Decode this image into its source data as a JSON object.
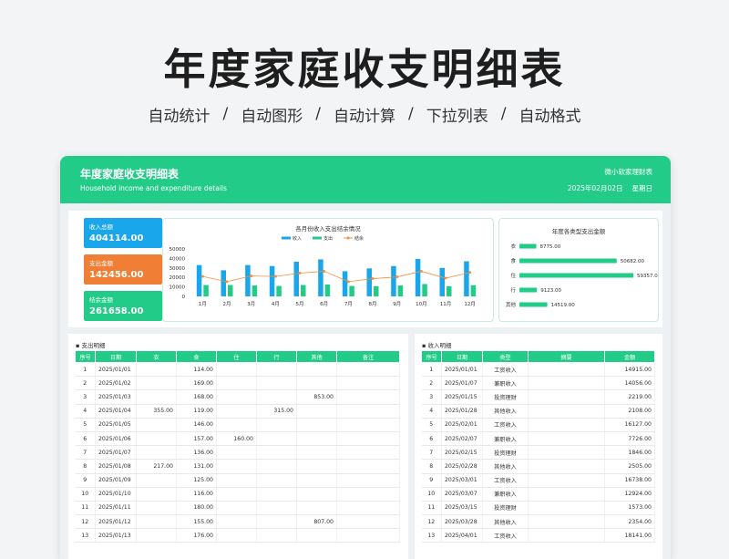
{
  "poster": {
    "title": "年度家庭收支明细表",
    "features": [
      "自动统计",
      "自动图形",
      "自动计算",
      "下拉列表",
      "自动格式"
    ],
    "separator": "/"
  },
  "header": {
    "title": "年度家庭收支明细表",
    "subtitle": "Household income and expenditure details",
    "brand": "微小软家理财表",
    "date": "2025年02月02日",
    "weekday": "星期日"
  },
  "colors": {
    "green": "#22cc88",
    "blue": "#1aa6ea",
    "orange": "#f07f35",
    "line": "#f0913f"
  },
  "summary": [
    {
      "label": "收入总额",
      "value": "404114.00",
      "color": "#1aa6ea"
    },
    {
      "label": "支出金额",
      "value": "142456.00",
      "color": "#f07f35"
    },
    {
      "label": "结余金额",
      "value": "261658.00",
      "color": "#22cc88"
    }
  ],
  "chart_data": [
    {
      "type": "bar",
      "title": "各月份收入支出结余情况",
      "categories": [
        "1月",
        "2月",
        "3月",
        "4月",
        "5月",
        "6月",
        "7月",
        "8月",
        "9月",
        "10月",
        "11月",
        "12月"
      ],
      "yticks": [
        "50000",
        "40000",
        "30000",
        "20000",
        "10000",
        "0"
      ],
      "ylim": [
        0,
        50000
      ],
      "legend_position": "top",
      "series": [
        {
          "name": "收入",
          "kind": "bar",
          "color": "#1aa6ea",
          "values": [
            33000,
            27500,
            33000,
            32000,
            36500,
            39000,
            26500,
            29500,
            32000,
            39500,
            30000,
            37000
          ]
        },
        {
          "name": "支出",
          "kind": "bar",
          "color": "#22cc88",
          "values": [
            12000,
            12000,
            11500,
            11000,
            12000,
            12500,
            11000,
            10800,
            11500,
            13000,
            10800,
            11800
          ]
        },
        {
          "name": "结余",
          "kind": "line",
          "color": "#f0913f",
          "values": [
            21000,
            15500,
            21500,
            21000,
            24500,
            26500,
            15500,
            18700,
            20500,
            26500,
            19200,
            25200
          ]
        }
      ]
    },
    {
      "type": "bar",
      "title": "年度各类型支出金额",
      "orientation": "horizontal",
      "categories": [
        "衣",
        "食",
        "住",
        "行",
        "其他"
      ],
      "values": [
        8775.0,
        50682.0,
        59357.0,
        9123.0,
        14519.0
      ],
      "labels": [
        "8775.00",
        "50682.00",
        "59357.00",
        "9123.00",
        "14519.00"
      ],
      "color": "#22cc88"
    }
  ],
  "expense": {
    "title": "支出明细",
    "columns": [
      "序号",
      "日期",
      "衣",
      "食",
      "住",
      "行",
      "其他",
      "备注"
    ],
    "rows": [
      [
        "1",
        "2025/01/01",
        "",
        "114.00",
        "",
        "",
        "",
        ""
      ],
      [
        "2",
        "2025/01/02",
        "",
        "169.00",
        "",
        "",
        "",
        ""
      ],
      [
        "3",
        "2025/01/03",
        "",
        "168.00",
        "",
        "",
        "853.00",
        ""
      ],
      [
        "4",
        "2025/01/04",
        "355.00",
        "119.00",
        "",
        "315.00",
        "",
        ""
      ],
      [
        "5",
        "2025/01/05",
        "",
        "146.00",
        "",
        "",
        "",
        ""
      ],
      [
        "6",
        "2025/01/06",
        "",
        "157.00",
        "160.00",
        "",
        "",
        ""
      ],
      [
        "7",
        "2025/01/07",
        "",
        "136.00",
        "",
        "",
        "",
        ""
      ],
      [
        "8",
        "2025/01/08",
        "217.00",
        "131.00",
        "",
        "",
        "",
        ""
      ],
      [
        "9",
        "2025/01/09",
        "",
        "125.00",
        "",
        "",
        "",
        ""
      ],
      [
        "10",
        "2025/01/10",
        "",
        "116.00",
        "",
        "",
        "",
        ""
      ],
      [
        "11",
        "2025/01/11",
        "",
        "180.00",
        "",
        "",
        "",
        ""
      ],
      [
        "12",
        "2025/01/12",
        "",
        "155.00",
        "",
        "",
        "807.00",
        ""
      ],
      [
        "13",
        "2025/01/13",
        "",
        "176.00",
        "",
        "",
        "",
        ""
      ]
    ]
  },
  "income": {
    "title": "收入明细",
    "columns": [
      "序号",
      "日期",
      "类型",
      "摘要",
      "金额"
    ],
    "rows": [
      [
        "1",
        "2025/01/01",
        "工资收入",
        "",
        "14915.00"
      ],
      [
        "2",
        "2025/01/07",
        "兼职收入",
        "",
        "14056.00"
      ],
      [
        "3",
        "2025/01/15",
        "投资理财",
        "",
        "2219.00"
      ],
      [
        "4",
        "2025/01/28",
        "其他收入",
        "",
        "2108.00"
      ],
      [
        "5",
        "2025/02/01",
        "工资收入",
        "",
        "16127.00"
      ],
      [
        "6",
        "2025/02/07",
        "兼职收入",
        "",
        "7726.00"
      ],
      [
        "7",
        "2025/02/15",
        "投资理财",
        "",
        "1846.00"
      ],
      [
        "8",
        "2025/02/28",
        "其他收入",
        "",
        "2505.00"
      ],
      [
        "9",
        "2025/03/01",
        "工资收入",
        "",
        "16738.00"
      ],
      [
        "10",
        "2025/03/07",
        "兼职收入",
        "",
        "12924.00"
      ],
      [
        "11",
        "2025/03/15",
        "投资理财",
        "",
        "1573.00"
      ],
      [
        "12",
        "2025/03/28",
        "其他收入",
        "",
        "2354.00"
      ],
      [
        "13",
        "2025/04/01",
        "工资收入",
        "",
        "18141.00"
      ]
    ]
  }
}
